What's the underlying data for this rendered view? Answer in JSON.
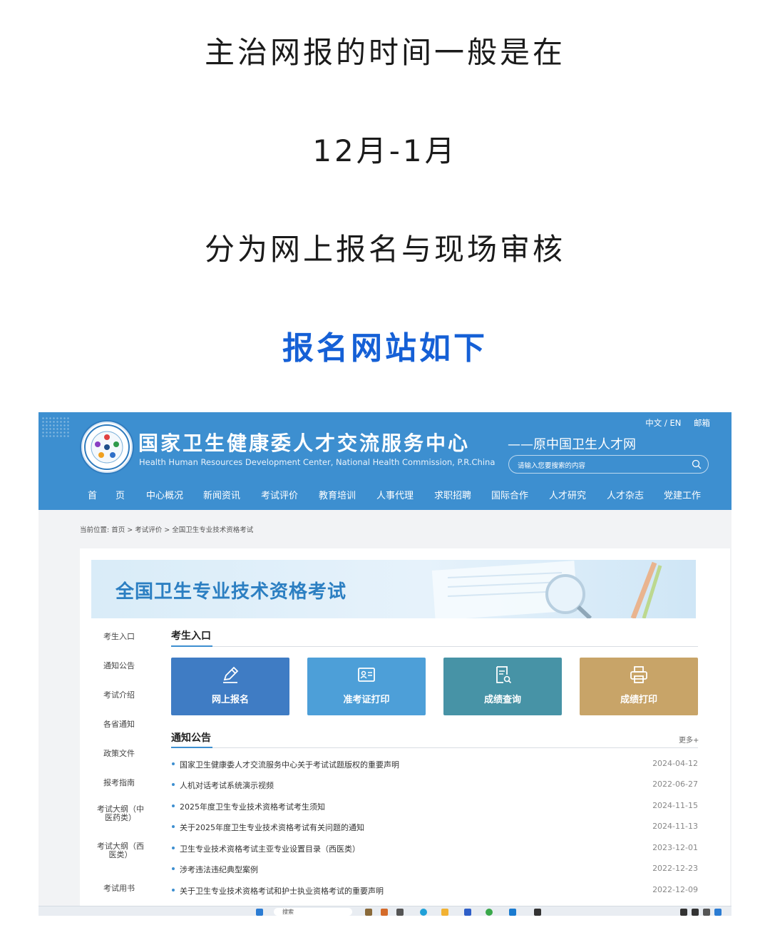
{
  "post": {
    "line1": "主治网报的时间一般是在",
    "line2": "12月-1月",
    "line3": "分为网上报名与现场审核",
    "line4": "报名网站如下",
    "accent_color": "#1560d6"
  },
  "site": {
    "title": "国家卫生健康委人才交流服务中心",
    "subtitle": "Health Human Resources Development Center, National Health Commission, P.R.China",
    "former_name": "——原中国卫生人才网",
    "top_links": [
      "中文 / EN",
      "邮箱"
    ],
    "search_placeholder": "请输入您要搜索的内容",
    "header_color": "#3d8fd0",
    "nav": [
      "首　　页",
      "中心概况",
      "新闻资讯",
      "考试评价",
      "教育培训",
      "人事代理",
      "求职招聘",
      "国际合作",
      "人才研究",
      "人才杂志",
      "党建工作"
    ]
  },
  "breadcrumb": "当前位置:  首页 > 考试评价 > 全国卫生专业技术资格考试",
  "banner_title": "全国卫生专业技术资格考试",
  "sidebar": [
    "考生入口",
    "通知公告",
    "考试介绍",
    "各省通知",
    "政策文件",
    "报考指南",
    "考试大纲（中医药类）",
    "考试大纲（西医类）",
    "考试用书"
  ],
  "entry": {
    "heading": "考生入口",
    "tiles": [
      {
        "label": "网上报名",
        "icon": "pencil-icon",
        "color": "#3f7cc4"
      },
      {
        "label": "准考证打印",
        "icon": "id-card-icon",
        "color": "#4d9fd8"
      },
      {
        "label": "成绩查询",
        "icon": "search-document-icon",
        "color": "#4793a6"
      },
      {
        "label": "成绩打印",
        "icon": "printer-icon",
        "color": "#c8a468"
      }
    ]
  },
  "notices": {
    "heading": "通知公告",
    "more": "更多+",
    "items": [
      {
        "title": "国家卫生健康委人才交流服务中心关于考试试题版权的重要声明",
        "date": "2024-04-12"
      },
      {
        "title": "人机对话考试系统演示视频",
        "date": "2022-06-27"
      },
      {
        "title": "2025年度卫生专业技术资格考试考生须知",
        "date": "2024-11-15"
      },
      {
        "title": "关于2025年度卫生专业技术资格考试有关问题的通知",
        "date": "2024-11-13"
      },
      {
        "title": "卫生专业技术资格考试主亚专业设置目录（西医类）",
        "date": "2023-12-01"
      },
      {
        "title": "涉考违法违纪典型案例",
        "date": "2022-12-23"
      },
      {
        "title": "关于卫生专业技术资格考试和护士执业资格考试的重要声明",
        "date": "2022-12-09"
      }
    ]
  },
  "taskbar": {
    "search_label": "搜索"
  }
}
